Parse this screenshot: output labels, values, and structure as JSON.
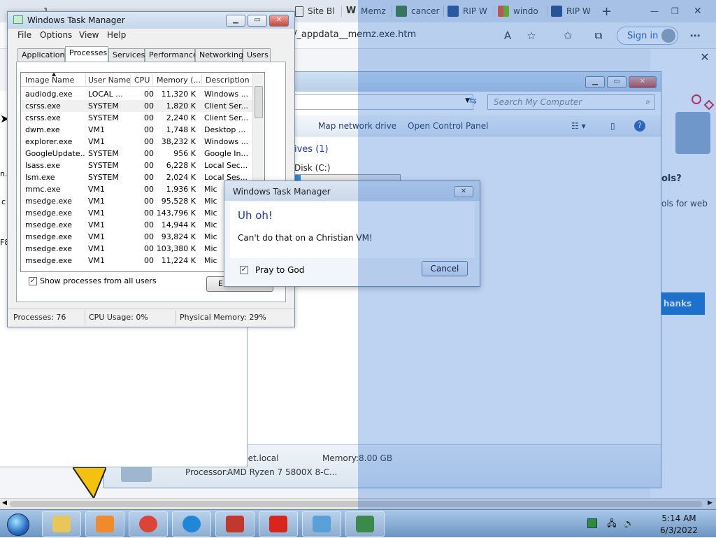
{
  "browser": {
    "tabs": [
      {
        "label": "Site Bl",
        "color": "#6b7a8c"
      },
      {
        "label": "Memz",
        "color": "#2b2b2b"
      },
      {
        "label": "cancer",
        "color": "#3b7a33"
      },
      {
        "label": "RIP W",
        "color": "#2c4f8a"
      },
      {
        "label": "windo",
        "color": "#e24a1c"
      },
      {
        "label": "RIP W",
        "color": "#274a7a"
      }
    ],
    "url": "/_appdata__memz.exe.htm",
    "signin_label": "Sign in",
    "side_pane": {
      "title": "ols?",
      "subtitle": "ols for web",
      "button_label": "hanks"
    },
    "left_fragments": [
      "n.",
      "c",
      "F8"
    ]
  },
  "explorer": {
    "search_placeholder": "Search My Computer",
    "toolbar": {
      "map_drive": "Map network drive",
      "control_panel": "Open Control Panel"
    },
    "drives_heading": "ives (1)",
    "disk_label": "Disk (C:)",
    "disk_used_fraction": 0.05,
    "details": {
      "domain_suffix": "net.local",
      "memory_label": "Memory:",
      "memory_value": "8.00 GB",
      "processor_label": "Processor:",
      "processor_value": "AMD Ryzen 7 5800X 8-C..."
    }
  },
  "taskmgr": {
    "title": "Windows Task Manager",
    "menu": [
      "File",
      "Options",
      "View",
      "Help"
    ],
    "tabs": [
      "Applications",
      "Processes",
      "Services",
      "Performance",
      "Networking",
      "Users"
    ],
    "active_tab": "Processes",
    "columns": [
      "Image Name",
      "User Name",
      "CPU",
      "Memory (...",
      "Description"
    ],
    "rows": [
      [
        "audiodg.exe",
        "LOCAL ...",
        "00",
        "11,320 K",
        "Windows ..."
      ],
      [
        "csrss.exe",
        "SYSTEM",
        "00",
        "1,820 K",
        "Client Ser..."
      ],
      [
        "csrss.exe",
        "SYSTEM",
        "00",
        "2,240 K",
        "Client Ser..."
      ],
      [
        "dwm.exe",
        "VM1",
        "00",
        "1,748 K",
        "Desktop ..."
      ],
      [
        "explorer.exe",
        "VM1",
        "00",
        "38,232 K",
        "Windows ..."
      ],
      [
        "GoogleUpdate...",
        "SYSTEM",
        "00",
        "956 K",
        "Google In..."
      ],
      [
        "lsass.exe",
        "SYSTEM",
        "00",
        "6,228 K",
        "Local Sec..."
      ],
      [
        "lsm.exe",
        "SYSTEM",
        "00",
        "2,024 K",
        "Local Ses..."
      ],
      [
        "mmc.exe",
        "VM1",
        "00",
        "1,936 K",
        "Mic"
      ],
      [
        "msedge.exe",
        "VM1",
        "00",
        "95,528 K",
        "Mic"
      ],
      [
        "msedge.exe",
        "VM1",
        "00",
        "143,796 K",
        "Mic"
      ],
      [
        "msedge.exe",
        "VM1",
        "00",
        "14,944 K",
        "Mic"
      ],
      [
        "msedge.exe",
        "VM1",
        "00",
        "93,824 K",
        "Mic"
      ],
      [
        "msedge.exe",
        "VM1",
        "00",
        "103,380 K",
        "Mic"
      ],
      [
        "msedge.exe",
        "VM1",
        "00",
        "11,224 K",
        "Mic"
      ]
    ],
    "show_all_label": "Show processes from all users",
    "show_all_checked": true,
    "end_button_label": "E",
    "status": {
      "processes": "Processes: 76",
      "cpu": "CPU Usage: 0%",
      "memory": "Physical Memory: 29%"
    }
  },
  "dialog": {
    "title": "Windows Task Manager",
    "heading": "Uh oh!",
    "message": "Can't do that on a Christian VM!",
    "checkbox_label": "Pray to God",
    "checkbox_checked": true,
    "cancel_label": "Cancel"
  },
  "taskbar": {
    "apps": [
      {
        "name": "explorer",
        "color": "#e8c65a"
      },
      {
        "name": "media-player",
        "color": "#f08a2a"
      },
      {
        "name": "chrome",
        "color": "#db4437"
      },
      {
        "name": "edge",
        "color": "#1e88d6"
      },
      {
        "name": "toolbox",
        "color": "#c0392b"
      },
      {
        "name": "error-app",
        "color": "#d8261c"
      },
      {
        "name": "control-panel",
        "color": "#5aa0d8"
      },
      {
        "name": "task-manager",
        "color": "#3a8a4a"
      }
    ],
    "time": "5:14 AM",
    "date": "6/3/2022"
  }
}
